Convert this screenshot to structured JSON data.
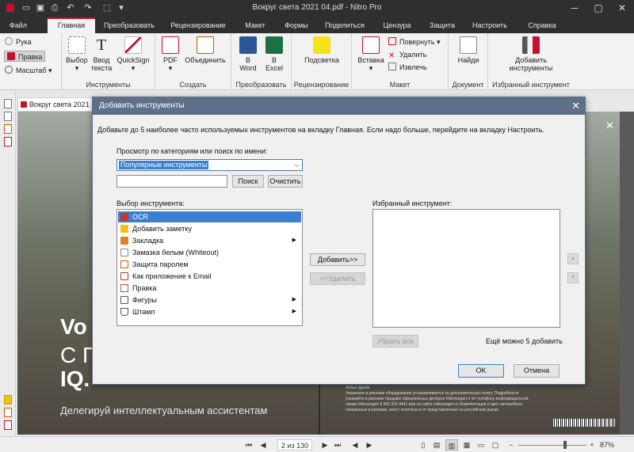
{
  "window": {
    "title": "Вокруг света 2021 04.pdf - Nitro Pro",
    "minimize": "─",
    "maximize": "▢",
    "close": "✕"
  },
  "menu": {
    "tabs": [
      "Файл",
      "Главная",
      "Преобразовать",
      "Рецензирование",
      "Макет",
      "Формы",
      "Поделиться",
      "Цензура",
      "Защита",
      "Настроить",
      "Справка"
    ],
    "active": "Главная"
  },
  "ribbon": {
    "hand": "Рука",
    "edit": "Правка",
    "zoom": "Масштаб",
    "select": "Выбор",
    "type_text_1": "Ввод",
    "type_text_2": "текста",
    "quicksign": "QuickSign",
    "group_tools": "Инструменты",
    "pdf": "PDF",
    "combine": "Объединить",
    "group_create": "Создать",
    "to_word_1": "В",
    "to_word_2": "Word",
    "to_excel_1": "В",
    "to_excel_2": "Excel",
    "group_convert": "Преобразовать",
    "highlight": "Подсветка",
    "group_review": "Рецензирование",
    "insert": "Вставка",
    "rotate": "Повернуть",
    "delete": "Удалить",
    "extract": "Извлечь",
    "group_layout": "Макет",
    "find": "Найди",
    "group_document": "Документ",
    "add_tools_1": "Добавить",
    "add_tools_2": "инструменты",
    "group_favorite": "Избранный инструмент"
  },
  "document": {
    "tab_title": "Вокруг света 2021",
    "text_vo": "Vo",
    "text_c": "С П",
    "text_iq": "IQ.",
    "text_deleg": "Делегируй интеллектуальным ассистентам",
    "small_lines": [
      "Акбью Драйв",
      "Указанное в рекламе оборудование устанавливается за дополнительную плату. Подробности",
      "узнавайте в рекламе продажи официальных дилеров Volkswagen и по телефону информационной",
      "линии Volkswagen 8 800 333 4441 или на сайте volkswagen.ru Комплектация и цвет автомобиля,",
      "показанные в рекламе, могут отличаться от представленных на российском рынке."
    ]
  },
  "status": {
    "page": "2 из 130",
    "zoom": "87%"
  },
  "dialog": {
    "title": "Добавить инструменты",
    "description": "Добавьте до 5 наиболее часто используемых инструментов на вкладку Главная. Если надо больше, перейдите на вкладку Настроить.",
    "browse_label": "Просмотр по категориям или поиск по имени:",
    "category_value": "Популярные инструменты",
    "search_value": "",
    "search_button": "Поиск",
    "clear_button": "Очистить",
    "choose_label": "Выбор инструмента:",
    "tools": [
      {
        "label": "OCR",
        "icon": "ocr-icon",
        "color": "#c0392b",
        "selected": true,
        "sub": false
      },
      {
        "label": "Добавить заметку",
        "icon": "note-icon",
        "color": "#f1c40f",
        "selected": false,
        "sub": false
      },
      {
        "label": "Закладка",
        "icon": "bookmark-icon",
        "color": "#e67e22",
        "selected": false,
        "sub": true
      },
      {
        "label": "Замазка белым (Whiteout)",
        "icon": "whiteout-icon",
        "color": "#7f8c8d",
        "selected": false,
        "sub": false
      },
      {
        "label": "Защита паролем",
        "icon": "lock-icon",
        "color": "#d35400",
        "selected": false,
        "sub": false
      },
      {
        "label": "Как приложение к Email",
        "icon": "email-icon",
        "color": "#b03a2e",
        "selected": false,
        "sub": false
      },
      {
        "label": "Правка",
        "icon": "edit-icon",
        "color": "#c0392b",
        "selected": false,
        "sub": false
      },
      {
        "label": "Фигуры",
        "icon": "shapes-icon",
        "color": "#555555",
        "selected": false,
        "sub": true
      },
      {
        "label": "Штамп",
        "icon": "stamp-icon",
        "color": "#555555",
        "selected": false,
        "sub": true
      }
    ],
    "add_button": "Добавить>>",
    "remove_button": "<<Удалить",
    "favorite_label": "Избранный инструмент:",
    "remove_all_button": "Убрать все",
    "remaining": "Ещё можно 5 добавить",
    "ok_button": "OK",
    "cancel_button": "Отмена",
    "up_glyph": "▲",
    "down_glyph": "▼"
  }
}
